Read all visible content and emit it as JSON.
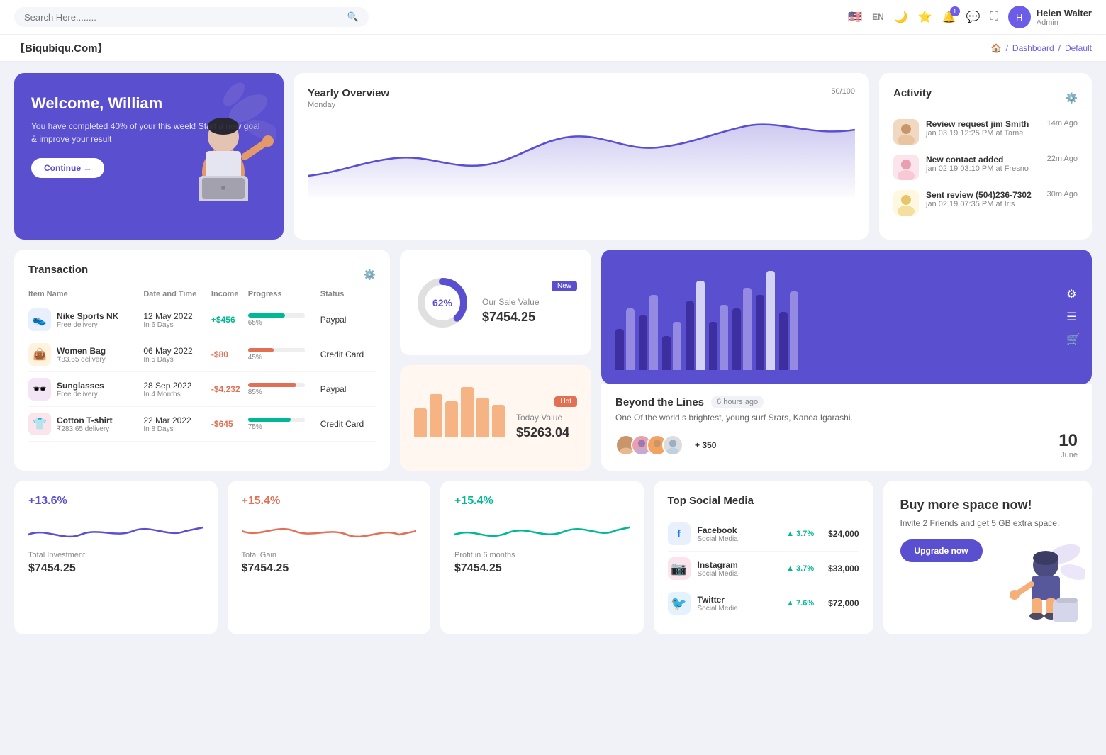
{
  "topNav": {
    "searchPlaceholder": "Search Here........",
    "language": "EN",
    "notificationCount": "1",
    "userName": "Helen Walter",
    "userRole": "Admin"
  },
  "breadcrumb": {
    "brand": "【Biqubiqu.Com】",
    "homeIcon": "🏠",
    "items": [
      "Dashboard",
      "Default"
    ]
  },
  "welcome": {
    "title": "Welcome, William",
    "description": "You have completed 40% of your this week! Start a new goal & improve your result",
    "buttonLabel": "Continue →"
  },
  "yearlyOverview": {
    "title": "Yearly Overview",
    "subtitle": "Monday",
    "badge": "50/100"
  },
  "activity": {
    "title": "Activity",
    "items": [
      {
        "name": "Review request jim Smith",
        "timeText": "jan 03 19 12:25 PM at Tame",
        "ago": "14m Ago"
      },
      {
        "name": "New contact added",
        "timeText": "jan 02 19 03:10 PM at Fresno",
        "ago": "22m Ago"
      },
      {
        "name": "Sent review (504)236-7302",
        "timeText": "jan 02 19 07:35 PM at Iris",
        "ago": "30m Ago"
      }
    ]
  },
  "transaction": {
    "title": "Transaction",
    "headers": [
      "Item Name",
      "Date and Time",
      "Income",
      "Progress",
      "Status"
    ],
    "rows": [
      {
        "icon": "👟",
        "iconBg": "#e8f0fe",
        "name": "Nike Sports NK",
        "sub": "Free delivery",
        "date": "12 May 2022",
        "dateSub": "In 6 Days",
        "income": "+$456",
        "incomeType": "pos",
        "progress": 65,
        "progressColor": "#00b894",
        "status": "Paypal"
      },
      {
        "icon": "👜",
        "iconBg": "#fff3e0",
        "name": "Women Bag",
        "sub": "₹83.65 delivery",
        "date": "06 May 2022",
        "dateSub": "In 5 Days",
        "income": "-$80",
        "incomeType": "neg",
        "progress": 45,
        "progressColor": "#e17055",
        "status": "Credit Card"
      },
      {
        "icon": "🕶️",
        "iconBg": "#f3e5f5",
        "name": "Sunglasses",
        "sub": "Free delivery",
        "date": "28 Sep 2022",
        "dateSub": "In 4 Months",
        "income": "-$4,232",
        "incomeType": "neg",
        "progress": 85,
        "progressColor": "#e17055",
        "status": "Paypal"
      },
      {
        "icon": "👕",
        "iconBg": "#fce4ec",
        "name": "Cotton T-shirt",
        "sub": "₹283.65 delivery",
        "date": "22 Mar 2022",
        "dateSub": "In 8 Days",
        "income": "-$645",
        "incomeType": "neg",
        "progress": 75,
        "progressColor": "#00b894",
        "status": "Credit Card"
      }
    ]
  },
  "saleValue": {
    "donutPct": 62,
    "donutLabel": "62%",
    "label": "Our Sale Value",
    "value": "$7454.25",
    "badge": "New"
  },
  "todayValue": {
    "label": "Today Value",
    "value": "$5263.04",
    "badge": "Hot",
    "bars": [
      40,
      60,
      50,
      70,
      55,
      45
    ]
  },
  "beyond": {
    "title": "Beyond the Lines",
    "timeAgo": "6 hours ago",
    "description": "One Of the world,s brightest, young surf Srars, Kanoa Igarashi.",
    "plusCount": "+ 350",
    "dateNum": "10",
    "dateMon": "June"
  },
  "miniStats": [
    {
      "pct": "+13.6%",
      "pctColor": "#5a4fcf",
      "label": "Total Investment",
      "value": "$7454.25",
      "waveColor": "#5a4fcf"
    },
    {
      "pct": "+15.4%",
      "pctColor": "#e17055",
      "label": "Total Gain",
      "value": "$7454.25",
      "waveColor": "#e17055"
    },
    {
      "pct": "+15.4%",
      "pctColor": "#00b894",
      "label": "Profit in 6 months",
      "value": "$7454.25",
      "waveColor": "#00b894"
    }
  ],
  "socialMedia": {
    "title": "Top Social Media",
    "items": [
      {
        "name": "Facebook",
        "sub": "Social Media",
        "icon": "f",
        "iconBg": "#1877f2",
        "growth": "3.7%",
        "value": "$24,000"
      },
      {
        "name": "Instagram",
        "sub": "Social Media",
        "icon": "📷",
        "iconBg": "#e1306c",
        "growth": "3.7%",
        "value": "$33,000"
      },
      {
        "name": "Twitter",
        "sub": "Social Media",
        "icon": "🐦",
        "iconBg": "#1da1f2",
        "growth": "7.6%",
        "value": "$72,000"
      }
    ]
  },
  "upgrade": {
    "title": "Buy more space now!",
    "description": "Invite 2 Friends and get 5 GB extra space.",
    "buttonLabel": "Upgrade now"
  },
  "barChart": {
    "bars": [
      {
        "heights": [
          60,
          90
        ],
        "type": [
          "dark",
          "light"
        ]
      },
      {
        "heights": [
          80,
          110
        ],
        "type": [
          "dark",
          "light"
        ]
      },
      {
        "heights": [
          50,
          70
        ],
        "type": [
          "dark",
          "light"
        ]
      },
      {
        "heights": [
          100,
          130
        ],
        "type": [
          "dark",
          "white"
        ]
      },
      {
        "heights": [
          70,
          95
        ],
        "type": [
          "dark",
          "light"
        ]
      },
      {
        "heights": [
          90,
          120
        ],
        "type": [
          "dark",
          "white"
        ]
      },
      {
        "heights": [
          110,
          145
        ],
        "type": [
          "dark",
          "white"
        ]
      },
      {
        "heights": [
          85,
          115
        ],
        "type": [
          "dark",
          "light"
        ]
      }
    ]
  }
}
